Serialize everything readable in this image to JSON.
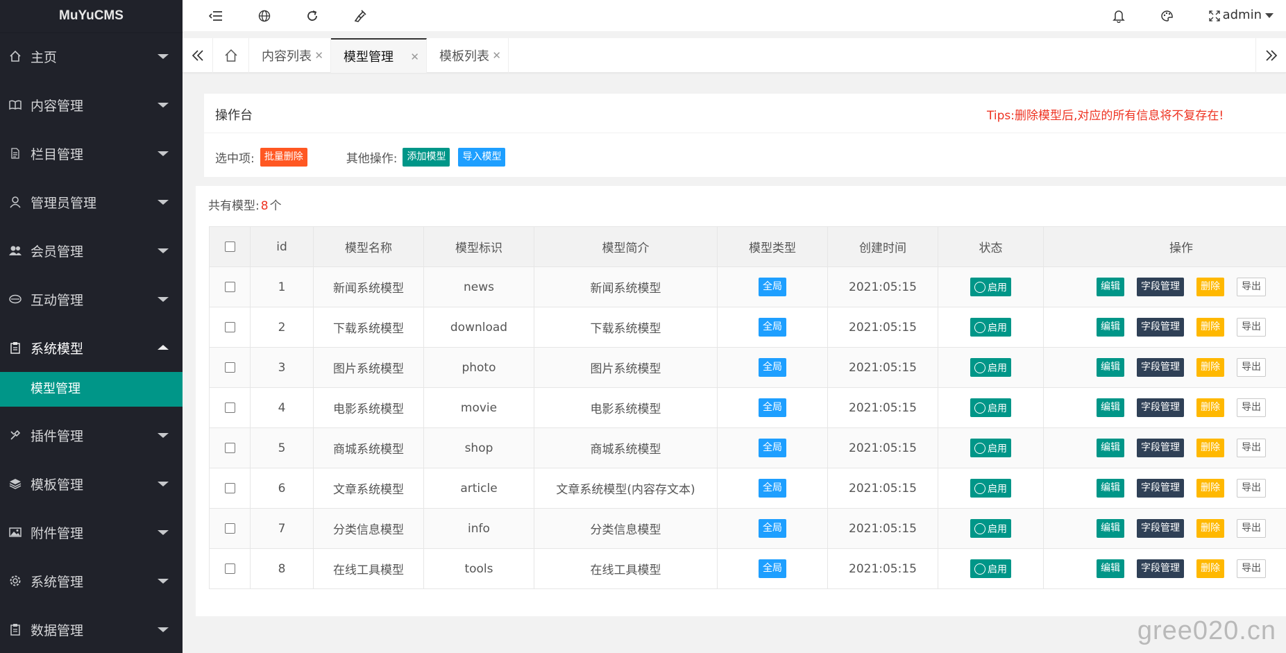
{
  "app": {
    "logo": "MuYuCMS"
  },
  "sidebar": {
    "items": [
      {
        "label": "主页",
        "icon": "home-icon"
      },
      {
        "label": "内容管理",
        "icon": "book-icon"
      },
      {
        "label": "栏目管理",
        "icon": "file-icon"
      },
      {
        "label": "管理员管理",
        "icon": "user-icon"
      },
      {
        "label": "会员管理",
        "icon": "users-icon"
      },
      {
        "label": "互动管理",
        "icon": "chat-icon"
      },
      {
        "label": "系统模型",
        "icon": "clipboard-icon",
        "open": true
      },
      {
        "label": "插件管理",
        "icon": "tools-icon"
      },
      {
        "label": "模板管理",
        "icon": "layers-icon"
      },
      {
        "label": "附件管理",
        "icon": "image-icon"
      },
      {
        "label": "系统管理",
        "icon": "gear-icon"
      },
      {
        "label": "数据管理",
        "icon": "clipboard-icon"
      }
    ],
    "subitem_active": "模型管理"
  },
  "header": {
    "user": "admin"
  },
  "tabs": [
    {
      "label": "内容列表"
    },
    {
      "label": "模型管理",
      "active": true
    },
    {
      "label": "模板列表"
    }
  ],
  "ops": {
    "title": "操作台",
    "tips": "Tips:删除模型后,对应的所有信息将不复存在!",
    "selected_label": "选中项:",
    "batch_delete": "批量删除",
    "other_label": "其他操作:",
    "add_model": "添加模型",
    "import_model": "导入模型"
  },
  "list": {
    "count_prefix": "共有模型:",
    "count": "8",
    "count_suffix": "个",
    "columns": [
      "id",
      "模型名称",
      "模型标识",
      "模型简介",
      "模型类型",
      "创建时间",
      "状态",
      "操作"
    ],
    "rows": [
      {
        "id": "1",
        "name": "新闻系统模型",
        "key": "news",
        "desc": "新闻系统模型",
        "type": "全局",
        "time": "2021:05:15",
        "status": "启用"
      },
      {
        "id": "2",
        "name": "下载系统模型",
        "key": "download",
        "desc": "下载系统模型",
        "type": "全局",
        "time": "2021:05:15",
        "status": "启用"
      },
      {
        "id": "3",
        "name": "图片系统模型",
        "key": "photo",
        "desc": "图片系统模型",
        "type": "全局",
        "time": "2021:05:15",
        "status": "启用"
      },
      {
        "id": "4",
        "name": "电影系统模型",
        "key": "movie",
        "desc": "电影系统模型",
        "type": "全局",
        "time": "2021:05:15",
        "status": "启用"
      },
      {
        "id": "5",
        "name": "商城系统模型",
        "key": "shop",
        "desc": "商城系统模型",
        "type": "全局",
        "time": "2021:05:15",
        "status": "启用"
      },
      {
        "id": "6",
        "name": "文章系统模型",
        "key": "article",
        "desc": "文章系统模型(内容存文本)",
        "type": "全局",
        "time": "2021:05:15",
        "status": "启用"
      },
      {
        "id": "7",
        "name": "分类信息模型",
        "key": "info",
        "desc": "分类信息模型",
        "type": "全局",
        "time": "2021:05:15",
        "status": "启用"
      },
      {
        "id": "8",
        "name": "在线工具模型",
        "key": "tools",
        "desc": "在线工具模型",
        "type": "全局",
        "time": "2021:05:15",
        "status": "启用"
      }
    ],
    "actions": {
      "edit": "编辑",
      "fields": "字段管理",
      "delete": "删除",
      "export": "导出"
    }
  },
  "watermark": "gree020.cn",
  "colors": {
    "sidebar_bg": "#20222a",
    "accent": "#009688",
    "danger": "#ff5722",
    "info": "#1e9fff",
    "warn": "#ffb800",
    "tips": "#ee3322"
  }
}
